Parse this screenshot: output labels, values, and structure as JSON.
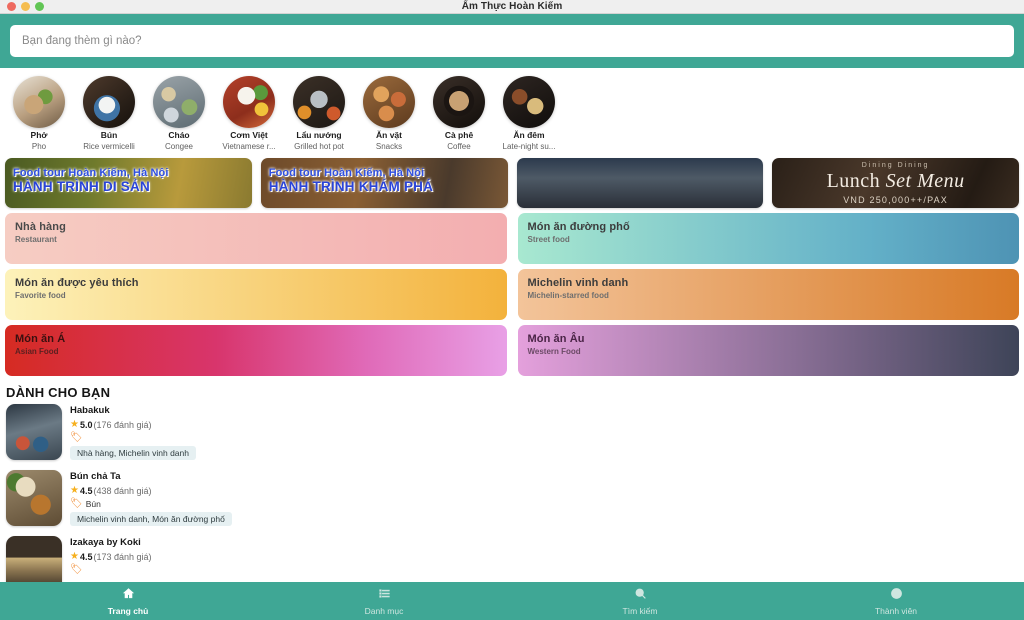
{
  "window": {
    "title": "Ẩm Thực Hoàn Kiếm",
    "traffic_lights": [
      "close",
      "minimize",
      "zoom"
    ]
  },
  "search": {
    "placeholder": "Bạn đang thèm gì nào?",
    "value": ""
  },
  "categories": [
    {
      "vn": "Phở",
      "en": "Pho",
      "icon": "pho-photo"
    },
    {
      "vn": "Bún",
      "en": "Rice vermicelli",
      "icon": "bun-photo"
    },
    {
      "vn": "Cháo",
      "en": "Congee",
      "icon": "chao-photo"
    },
    {
      "vn": "Cơm Việt",
      "en": "Vietnamese r...",
      "icon": "com-viet-photo"
    },
    {
      "vn": "Lẩu nướng",
      "en": "Grilled hot pot",
      "icon": "lau-nuong-photo"
    },
    {
      "vn": "Ăn vặt",
      "en": "Snacks",
      "icon": "an-vat-photo"
    },
    {
      "vn": "Cà phê",
      "en": "Coffee",
      "icon": "ca-phe-photo"
    },
    {
      "vn": "Ăn đêm",
      "en": "Late-night su...",
      "icon": "an-dem-photo"
    }
  ],
  "banners": [
    {
      "line1": "Food tour Hoàn Kiếm, Hà Nội",
      "line2": "HÀNH TRÌNH DI SẢN"
    },
    {
      "line1": "Food tour Hoàn Kiếm, Hà Nội",
      "line2": "HÀNH TRÌNH KHÁM PHÁ"
    },
    {
      "line1": "",
      "line2": ""
    },
    {
      "top": "Dining Dining",
      "title_main": "Lunch",
      "title_script": "Set Menu",
      "price": "VND 250,000++/PAX"
    }
  ],
  "category_cards": {
    "left": [
      {
        "vn": "Nhà hàng",
        "en": "Restaurant"
      },
      {
        "vn": "Món ăn được yêu thích",
        "en": "Favorite food"
      },
      {
        "vn": "Món ăn Á",
        "en": "Asian Food"
      }
    ],
    "right": [
      {
        "vn": "Món ăn đường phố",
        "en": "Street food"
      },
      {
        "vn": "Michelin vinh danh",
        "en": "Michelin-starred food"
      },
      {
        "vn": "Món ăn Âu",
        "en": "Western Food"
      }
    ]
  },
  "for_you": {
    "title": "DÀNH CHO BẠN",
    "items": [
      {
        "name": "Habakuk",
        "rating": "5.0",
        "reviews": "(176 đánh giá)",
        "tag": "",
        "chip": "Nhà hàng, Michelin vinh danh"
      },
      {
        "name": "Bún chả Ta",
        "rating": "4.5",
        "reviews": "(438 đánh giá)",
        "tag": "Bún",
        "chip": "Michelin vinh danh, Món ăn đường phố"
      },
      {
        "name": "Izakaya by Koki",
        "rating": "4.5",
        "reviews": "(173 đánh giá)",
        "tag": "",
        "chip": ""
      }
    ]
  },
  "bottom_nav": [
    {
      "label": "Trang chủ",
      "icon": "home-icon",
      "active": true
    },
    {
      "label": "Danh mục",
      "icon": "list-icon",
      "active": false
    },
    {
      "label": "Tìm kiếm",
      "icon": "search-icon",
      "active": false
    },
    {
      "label": "Thành viên",
      "icon": "account-icon",
      "active": false
    }
  ],
  "colors": {
    "accent_teal": "#3fa795",
    "titlebar": "#efefef",
    "star": "#f6b01e",
    "chip_bg": "#e6f0f2",
    "banner_text": "#2a44d8"
  }
}
